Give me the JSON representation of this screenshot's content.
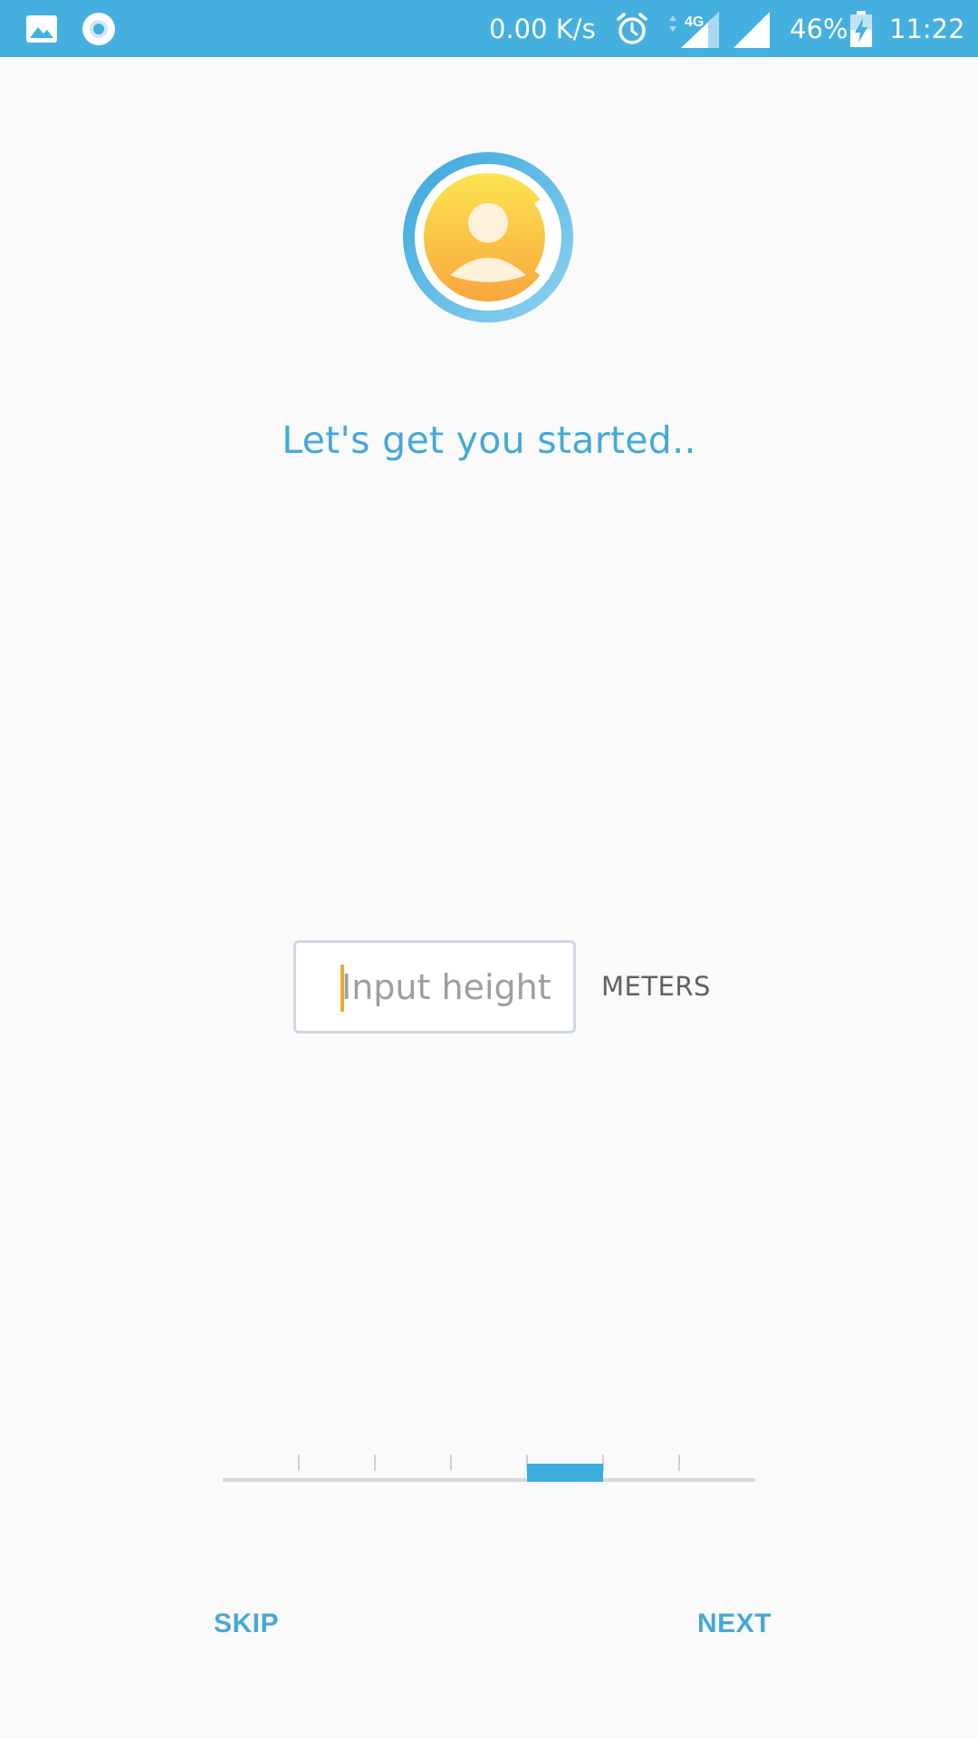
{
  "status_bar": {
    "network_speed": "0.00 K/s",
    "network_type": "4G",
    "battery_percent": "46%",
    "time": "11:22",
    "icons": [
      "gallery-icon",
      "circle-app-icon",
      "alarm-icon",
      "signal-4g-icon",
      "signal-icon",
      "battery-charging-icon"
    ],
    "background_color": "#45b0e0"
  },
  "avatar": {
    "icon": "user-avatar-icon"
  },
  "onboarding": {
    "headline": "Let's get you started..",
    "height_input": {
      "value": "",
      "placeholder": "Input height"
    },
    "unit": "METERS"
  },
  "progress": {
    "total_steps": 7,
    "current_step": 5,
    "active_color": "#3badde"
  },
  "buttons": {
    "skip": "SKIP",
    "next": "NEXT"
  },
  "colors": {
    "accent": "#45a9d6",
    "cursor": "#f0a830",
    "background": "#fafafa"
  }
}
